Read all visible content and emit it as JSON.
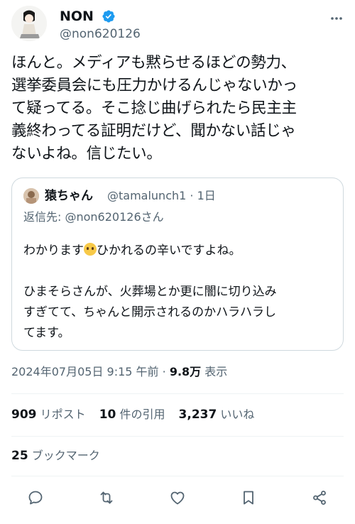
{
  "author": {
    "name": "NON",
    "handle": "@non620126"
  },
  "tweet": {
    "text": "ほんと。メディアも黙らせるほどの勢力、\n選挙委員会にも圧力かけるんじゃないかっ\nて疑ってる。そこ捻じ曲げられたら民主主\n義終わってる証明だけど、聞かない話じゃ\nないよね。信じたい。"
  },
  "quote": {
    "name": "猿ちゃん",
    "handle": "@tamalunch1 · 1日",
    "reply_to": "返信先: @non620126さん",
    "line1_before": "わかります",
    "line1_after": "ひかれるの辛いですよね。",
    "body": "ひまそらさんが、火葬場とか更に闇に切り込み\nすぎてて、ちゃんと開示されるのかハラハラし\nてます。"
  },
  "meta": {
    "timestamp": "2024年07月05日 9:15 午前 · ",
    "views_value": "9.8万",
    "views_label": " 表示"
  },
  "stats": {
    "reposts_value": "909",
    "reposts_label": " リポスト",
    "quotes_value": "10",
    "quotes_label": " 件の引用",
    "likes_value": "3,237",
    "likes_label": " いいね",
    "bookmarks_value": "25",
    "bookmarks_label": " ブックマーク"
  },
  "icons": {
    "verified": "verified-badge-icon",
    "reply": "reply-icon",
    "repost": "repost-icon",
    "like": "heart-icon",
    "bookmark": "bookmark-icon",
    "share": "share-icon"
  },
  "colors": {
    "verified_blue": "#1d9bf0",
    "secondary_text": "#536471",
    "border": "#cfd9de"
  }
}
